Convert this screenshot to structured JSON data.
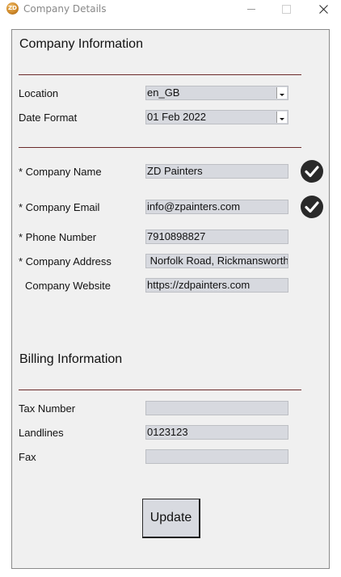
{
  "window": {
    "title": "Company Details",
    "icon_text": "ZD"
  },
  "company_info": {
    "heading": "Company Information",
    "location_label": "Location",
    "location_value": "en_GB",
    "date_format_label": "Date Format",
    "date_format_value": "01 Feb 2022",
    "company_name_label": "* Company Name",
    "company_name_value": "ZD Painters",
    "company_email_label": "* Company Email",
    "company_email_value": "info@zpainters.com",
    "phone_label": "* Phone Number",
    "phone_value": "7910898827",
    "address_label": "* Company Address",
    "address_value": " Norfolk Road, Rickmansworth",
    "website_label": "Company Website",
    "website_value": "https://zdpainters.com"
  },
  "billing_info": {
    "heading": "Billing Information",
    "tax_label": "Tax Number",
    "tax_value": "",
    "landlines_label": "Landlines",
    "landlines_value": "0123123",
    "fax_label": "Fax",
    "fax_value": ""
  },
  "actions": {
    "update_label": "Update"
  },
  "icons": {
    "valid_check": "check-circle-icon",
    "minimize": "minimize-icon",
    "maximize": "maximize-icon",
    "close": "close-icon"
  },
  "colors": {
    "divider": "#6b2a2a",
    "field_bg": "#d7d9df",
    "panel_bg": "#f0f0f0"
  }
}
